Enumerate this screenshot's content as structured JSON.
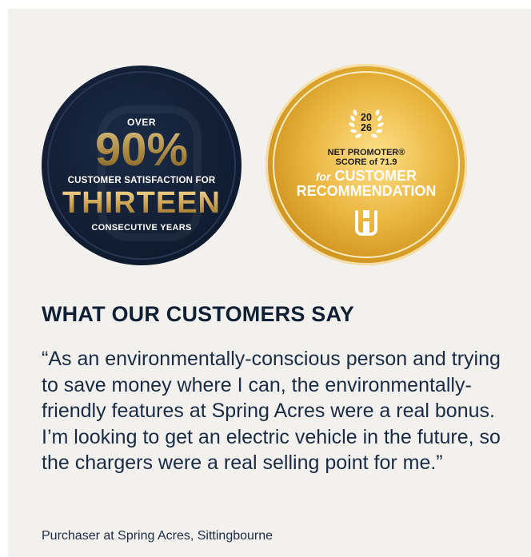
{
  "badges": {
    "satisfaction": {
      "over": "OVER",
      "percent": "90%",
      "line": "CUSTOMER SATISFACTION FOR",
      "years_word": "THIRTEEN",
      "suffix": "CONSECUTIVE YEARS"
    },
    "nps": {
      "year_top": "20",
      "year_bottom": "26",
      "line1": "NET PROMOTER®",
      "line2": "SCORE of 71.9",
      "for": "for",
      "customer": "CUSTOMER",
      "recommendation": "RECOMMENDATION"
    }
  },
  "testimonial": {
    "heading": "WHAT OUR CUSTOMERS SAY",
    "quote": "“As an environmentally-conscious person and trying to save money where I can, the environmentally-friendly features at Spring Acres were a real bonus. I’m looking to get an electric vehicle in the future, so the chargers were a real selling point for me.”",
    "attribution": "Purchaser at Spring Acres, Sittingbourne"
  },
  "colors": {
    "navy": "#0f1b2f",
    "gold": "#e8b43b",
    "text": "#1a2b45",
    "panel": "#f3f1ee"
  }
}
